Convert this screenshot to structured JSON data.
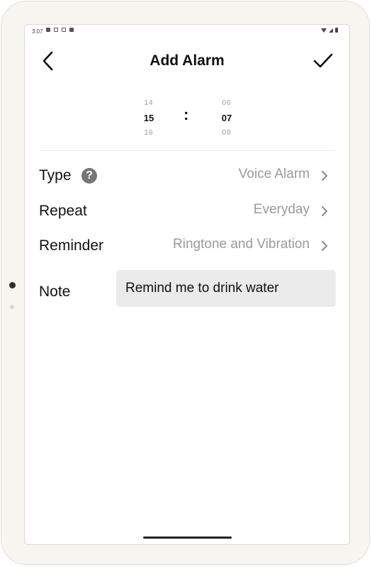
{
  "status_bar": {
    "time": "3:07"
  },
  "header": {
    "title": "Add Alarm",
    "back_icon": "chevron-left-icon",
    "confirm_icon": "checkmark-icon"
  },
  "time_picker": {
    "hour": {
      "above": "14",
      "selected": "15",
      "below": "16"
    },
    "separator": ":",
    "minute": {
      "above": "06",
      "selected": "07",
      "below": "08"
    }
  },
  "settings": {
    "type": {
      "label": "Type",
      "value": "Voice Alarm",
      "help_icon": "question-icon",
      "help_glyph": "?"
    },
    "repeat": {
      "label": "Repeat",
      "value": "Everyday"
    },
    "reminder": {
      "label": "Reminder",
      "value": "Ringtone and Vibration"
    },
    "note": {
      "label": "Note",
      "value": "Remind me to drink water"
    }
  },
  "colors": {
    "accent_text": "#111111",
    "secondary_text": "#9a9a9a",
    "input_background": "#ebebeb"
  }
}
